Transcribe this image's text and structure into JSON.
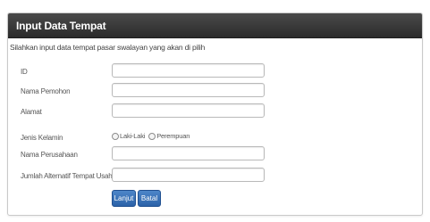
{
  "panel": {
    "title": "Input Data Tempat",
    "intro": "Silahkan input data tempat pasar swalayan yang akan di pilih"
  },
  "form": {
    "id_label": "ID",
    "id_value": "",
    "nama_pemohon_label": "Nama Pemohon",
    "nama_pemohon_value": "",
    "alamat_label": "Alamat",
    "alamat_value": "",
    "jenis_kelamin_label": "Jenis Kelamin",
    "jenis_kelamin_options": [
      "Laki-Laki",
      "Perempuan"
    ],
    "nama_perusahaan_label": "Nama Perusahaan",
    "nama_perusahaan_value": "",
    "jumlah_alternatif_label": "Jumlah Alternatif Tempat Usaha",
    "jumlah_alternatif_value": ""
  },
  "actions": {
    "next_label": "Lanjut",
    "cancel_label": "Batal"
  },
  "colors": {
    "header": "#2b2b2b",
    "button": "#2f66ad",
    "panel_border": "#c9c9c9"
  }
}
